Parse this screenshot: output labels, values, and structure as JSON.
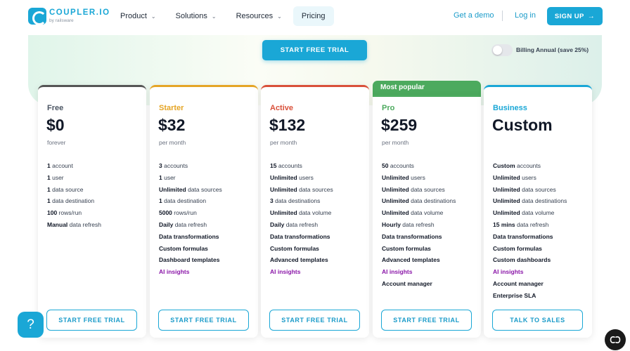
{
  "header": {
    "logo_name": "COUPLER.IO",
    "logo_sub": "by railsware",
    "nav": [
      {
        "label": "Product",
        "dropdown": true
      },
      {
        "label": "Solutions",
        "dropdown": true
      },
      {
        "label": "Resources",
        "dropdown": true
      },
      {
        "label": "Pricing",
        "dropdown": false
      }
    ],
    "demo_label": "Get a demo",
    "login_label": "Log in",
    "signup_label": "SIGN UP"
  },
  "hero": {
    "trial_label": "START FREE TRIAL",
    "billing_label": "Billing Annual (save 25%)",
    "billing_annual": false
  },
  "popular_label": "Most popular",
  "plans": [
    {
      "name": "Free",
      "accent": "#555555",
      "price": "$0",
      "period": "forever",
      "features": [
        {
          "bold": "1",
          "text": " account"
        },
        {
          "bold": "1",
          "text": " user"
        },
        {
          "bold": "1",
          "text": " data source"
        },
        {
          "bold": "1",
          "text": " data destination"
        },
        {
          "bold": "100",
          "text": " rows/run"
        },
        {
          "bold": "Manual",
          "text": " data refresh"
        }
      ],
      "cta": "START FREE TRIAL"
    },
    {
      "name": "Starter",
      "accent": "#e5a526",
      "price": "$32",
      "period": "per month",
      "features": [
        {
          "bold": "3",
          "text": " accounts"
        },
        {
          "bold": "1",
          "text": " user"
        },
        {
          "bold": "Unlimited",
          "text": " data sources"
        },
        {
          "bold": "1",
          "text": " data destination"
        },
        {
          "bold": "5000",
          "text": " rows/run"
        },
        {
          "bold": "Daily",
          "text": " data refresh"
        },
        {
          "bold": "Data transformations",
          "text": ""
        },
        {
          "bold": "Custom formulas",
          "text": ""
        },
        {
          "bold": "Dashboard templates",
          "text": ""
        },
        {
          "bold": "",
          "text": "AI insights",
          "ai": true
        }
      ],
      "cta": "START FREE TRIAL"
    },
    {
      "name": "Active",
      "accent": "#d9503a",
      "price": "$132",
      "period": "per month",
      "features": [
        {
          "bold": "15",
          "text": " accounts"
        },
        {
          "bold": "Unlimited",
          "text": " users"
        },
        {
          "bold": "Unlimited",
          "text": " data sources"
        },
        {
          "bold": "3",
          "text": " data destinations"
        },
        {
          "bold": "Unlimited",
          "text": " data volume"
        },
        {
          "bold": "Daily",
          "text": " data refresh"
        },
        {
          "bold": "Data transformations",
          "text": ""
        },
        {
          "bold": "Custom formulas",
          "text": ""
        },
        {
          "bold": "Advanced templates",
          "text": ""
        },
        {
          "bold": "",
          "text": "AI insights",
          "ai": true
        }
      ],
      "cta": "START FREE TRIAL"
    },
    {
      "name": "Pro",
      "accent": "#4caa5e",
      "price": "$259",
      "period": "per month",
      "features": [
        {
          "bold": "50",
          "text": " accounts"
        },
        {
          "bold": "Unlimited",
          "text": " users"
        },
        {
          "bold": "Unlimited",
          "text": " data sources"
        },
        {
          "bold": "Unlimited",
          "text": " data destinations"
        },
        {
          "bold": "Unlimited",
          "text": " data volume"
        },
        {
          "bold": "Hourly",
          "text": " data refresh"
        },
        {
          "bold": "Data transformations",
          "text": ""
        },
        {
          "bold": "Custom formulas",
          "text": ""
        },
        {
          "bold": "Advanced templates",
          "text": ""
        },
        {
          "bold": "",
          "text": "AI insights",
          "ai": true
        },
        {
          "bold": "Account manager",
          "text": ""
        }
      ],
      "cta": "START FREE TRIAL"
    },
    {
      "name": "Business",
      "accent": "#1aa7d6",
      "price": "Custom",
      "period": "",
      "features": [
        {
          "bold": "Custom",
          "text": " accounts"
        },
        {
          "bold": "Unlimited",
          "text": " users"
        },
        {
          "bold": "Unlimited",
          "text": " data sources"
        },
        {
          "bold": "Unlimited",
          "text": " data destinations"
        },
        {
          "bold": "Unlimited",
          "text": " data volume"
        },
        {
          "bold": "15 mins",
          "text": " data refresh"
        },
        {
          "bold": "Data transformations",
          "text": ""
        },
        {
          "bold": "Custom formulas",
          "text": ""
        },
        {
          "bold": "Custom dashboards",
          "text": ""
        },
        {
          "bold": "",
          "text": "AI insights",
          "ai": true
        },
        {
          "bold": "Account manager",
          "text": ""
        },
        {
          "bold": "Enterprise SLA",
          "text": ""
        }
      ],
      "cta": "TALK TO SALES"
    }
  ],
  "floating": {
    "help_icon": "question-icon",
    "help_label": "?",
    "cookie_icon": "cookie-settings-icon"
  },
  "colors": {
    "brand": "#1aa7d6",
    "ai_insights": "#8a16a8",
    "popular": "#4caa5e"
  }
}
